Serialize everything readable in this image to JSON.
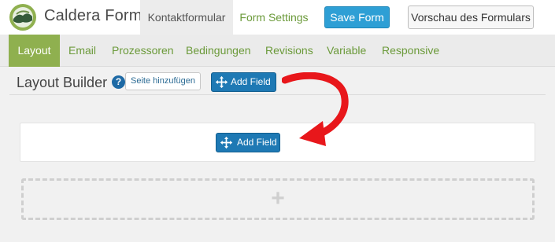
{
  "header": {
    "brand": "Caldera Forms",
    "form_name": "Kontaktformular",
    "form_settings": "Form Settings",
    "save_label": "Save Form",
    "preview_label": "Vorschau des Formulars"
  },
  "tabs": [
    {
      "label": "Layout",
      "active": true
    },
    {
      "label": "Email"
    },
    {
      "label": "Prozessoren"
    },
    {
      "label": "Bedingungen"
    },
    {
      "label": "Revisions"
    },
    {
      "label": "Variable"
    },
    {
      "label": "Responsive"
    }
  ],
  "builder": {
    "title": "Layout Builder",
    "help": "?",
    "add_page_label": "Seite hinzufügen",
    "add_field_label": "Add Field"
  },
  "canvas": {
    "add_field_label": "Add Field",
    "add_row_symbol": "+"
  },
  "colors": {
    "accent_green": "#8fb04f",
    "link_green": "#6b9a3a",
    "primary_blue": "#2e9fd5",
    "dark_blue": "#1e79b4",
    "annotation_red": "#e8171b"
  },
  "icons": [
    "caldera-logo-icon",
    "help-icon",
    "move-icon",
    "plus-icon",
    "red-arrow-annotation"
  ]
}
